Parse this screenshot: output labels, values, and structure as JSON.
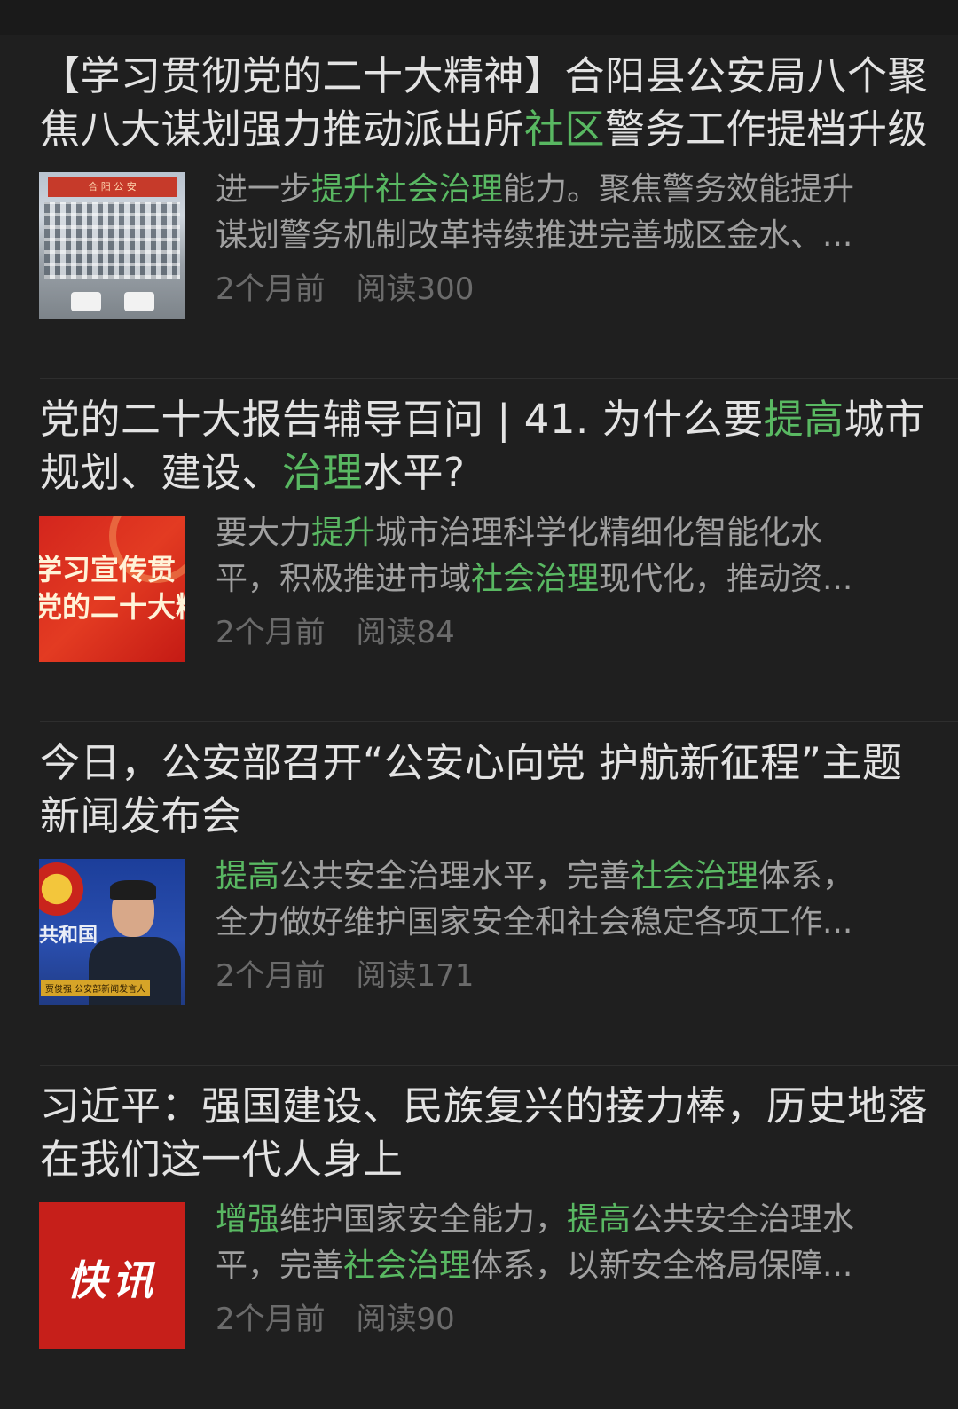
{
  "articles": [
    {
      "title_lines": [
        [
          {
            "t": "【学习贯彻党的二十大精神】合阳县公安局八个聚",
            "h": false
          }
        ],
        [
          {
            "t": "焦八大谋划强力推动派出所",
            "h": false
          },
          {
            "t": "社区",
            "h": true
          },
          {
            "t": "警务工作提档升级",
            "h": false
          }
        ]
      ],
      "summary_lines": [
        [
          {
            "t": "进一步",
            "h": false
          },
          {
            "t": "提升社会治理",
            "h": true
          },
          {
            "t": "能力。聚焦警务效能提升",
            "h": false
          }
        ],
        [
          {
            "t": "谋划警务机制改革持续推进完善城区金水、...",
            "h": false
          }
        ]
      ],
      "time": "2个月前",
      "reads": "阅读300",
      "thumb": "building-photo",
      "thumb_sign_text": "合 阳 公 安"
    },
    {
      "title_lines": [
        [
          {
            "t": "党的二十大报告辅导百问 | 41. 为什么要",
            "h": false
          },
          {
            "t": "提高",
            "h": true
          },
          {
            "t": "城市",
            "h": false
          }
        ],
        [
          {
            "t": "规划、建设、",
            "h": false
          },
          {
            "t": "治理",
            "h": true
          },
          {
            "t": "水平?",
            "h": false
          }
        ]
      ],
      "summary_lines": [
        [
          {
            "t": "要大力",
            "h": false
          },
          {
            "t": "提升",
            "h": true
          },
          {
            "t": "城市治理科学化精细化智能化水",
            "h": false
          }
        ],
        [
          {
            "t": "平，积极推进市域",
            "h": false
          },
          {
            "t": "社会治理",
            "h": true
          },
          {
            "t": "现代化，推动资...",
            "h": false
          }
        ]
      ],
      "time": "2个月前",
      "reads": "阅读84",
      "thumb": "red-banner",
      "thumb_text_lines": [
        "学习宣传贯",
        "党的二十大精"
      ]
    },
    {
      "title_lines": [
        [
          {
            "t": "今日，公安部召开“公安心向党 护航新征程”主题",
            "h": false
          }
        ],
        [
          {
            "t": "新闻发布会",
            "h": false
          }
        ]
      ],
      "summary_lines": [
        [
          {
            "t": "提高",
            "h": true
          },
          {
            "t": "公共安全治理水平，完善",
            "h": false
          },
          {
            "t": "社会治理",
            "h": true
          },
          {
            "t": "体系，",
            "h": false
          }
        ],
        [
          {
            "t": "全力做好维护国家安全和社会稳定各项工作...",
            "h": false
          }
        ]
      ],
      "time": "2个月前",
      "reads": "阅读171",
      "thumb": "police-spokesperson",
      "thumb_bg_text": "共和国",
      "thumb_caption": "贾俊强 公安部新闻发言人"
    },
    {
      "title_lines": [
        [
          {
            "t": "习近平：强国建设、民族复兴的接力棒，历史地落",
            "h": false
          }
        ],
        [
          {
            "t": "在我们这一代人身上",
            "h": false
          }
        ]
      ],
      "summary_lines": [
        [
          {
            "t": "增强",
            "h": true
          },
          {
            "t": "维护国家安全能力，",
            "h": false
          },
          {
            "t": "提高",
            "h": true
          },
          {
            "t": "公共安全治理水",
            "h": false
          }
        ],
        [
          {
            "t": "平，完善",
            "h": false
          },
          {
            "t": "社会治理",
            "h": true
          },
          {
            "t": "体系，以新安全格局保障...",
            "h": false
          }
        ]
      ],
      "time": "2个月前",
      "reads": "阅读90",
      "thumb": "flash-news",
      "thumb_word": "快讯"
    }
  ],
  "colors": {
    "background": "#1f1f1f",
    "title": "#e3e3e3",
    "summary": "#a0a0a0",
    "meta": "#6b6b6b",
    "highlight": "#59b862"
  }
}
